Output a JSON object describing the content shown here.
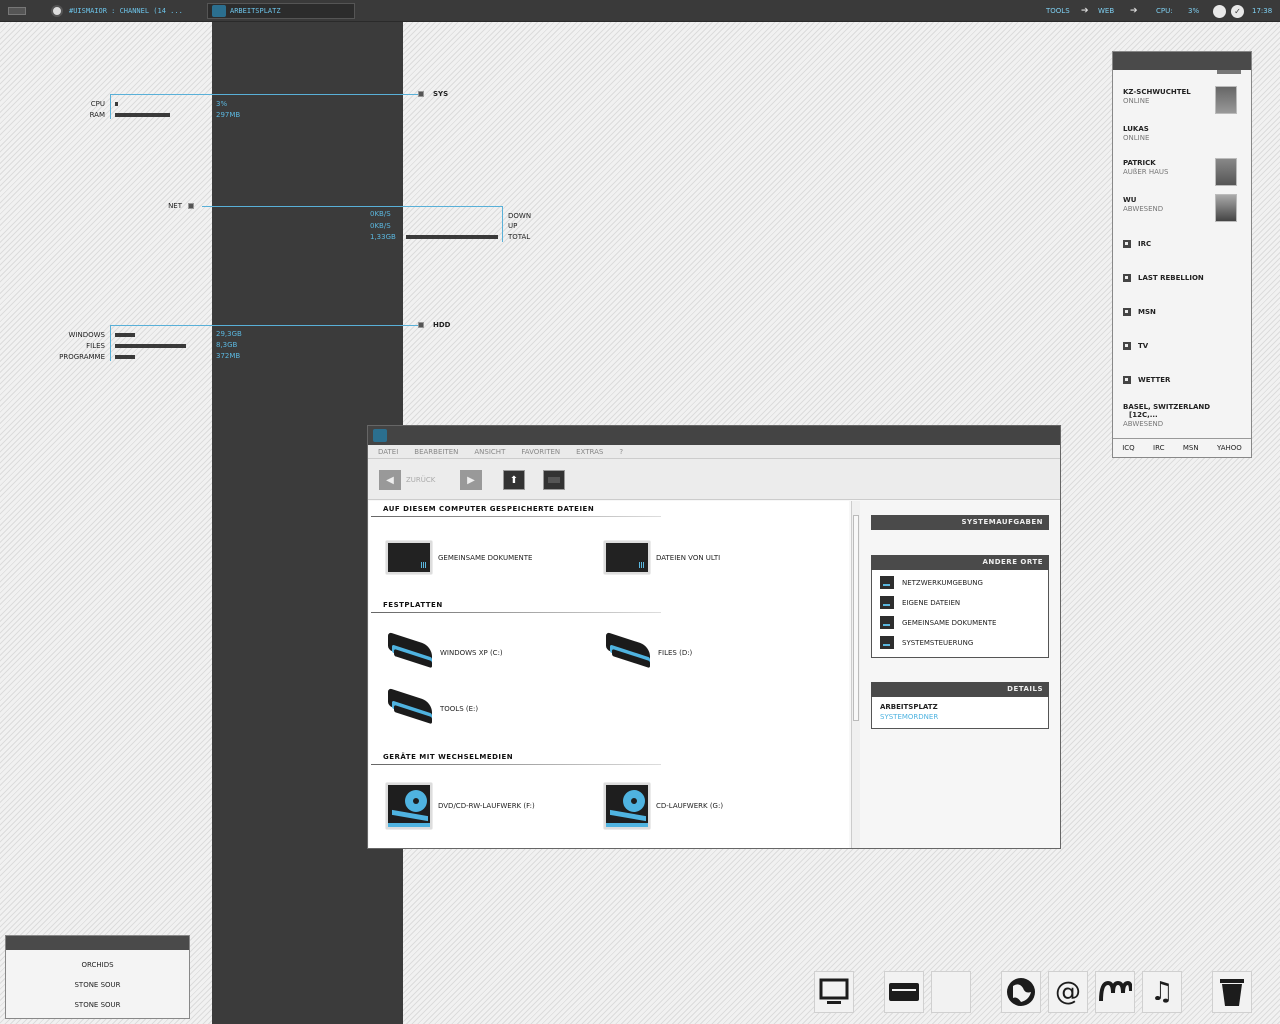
{
  "taskbar": {
    "task1": "#UISMAIOR : CHANNEL (14 ...",
    "task2": "ARBEITSPLATZ",
    "tools": "TOOLS",
    "web": "WEB",
    "cpu_label": "CPU:",
    "cpu_value": "3%",
    "time": "17:38"
  },
  "monitor": {
    "sys_title": "SYS",
    "cpu_label": "CPU",
    "cpu_value": "3%",
    "ram_label": "RAM",
    "ram_value": "297MB",
    "net_title": "NET",
    "down_value": "0KB/S",
    "up_value": "0KB/S",
    "total_value": "1,33GB",
    "down_label": "DOWN",
    "up_label": "UP",
    "total_label": "TOTAL",
    "hdd_title": "HDD",
    "drives": [
      {
        "label": "WINDOWS",
        "value": "29,3GB"
      },
      {
        "label": "FILES",
        "value": "8,3GB"
      },
      {
        "label": "PROGRAMME",
        "value": "372MB"
      }
    ]
  },
  "buddies": [
    {
      "name": "KZ-SCHWUCHTEL",
      "status": "ONLINE"
    },
    {
      "name": "LUKAS",
      "status": "ONLINE"
    },
    {
      "name": "PATRICK",
      "status": "AUßER HAUS"
    },
    {
      "name": "WU",
      "status": "ABWESEND"
    }
  ],
  "buddy_groups": [
    "IRC",
    "LAST REBELLION",
    "MSN",
    "TV",
    "WETTER"
  ],
  "weather": {
    "location": "BASEL, SWITZERLAND",
    "temp": "[12C,...",
    "status": "ABWESEND"
  },
  "buddy_tabs": [
    "ICQ",
    "IRC",
    "MSN",
    "YAHOO"
  ],
  "music": [
    "ORCHIDS",
    "STONE SOUR",
    "STONE SOUR"
  ],
  "explorer": {
    "menu": [
      "DATEI",
      "BEARBEITEN",
      "ANSICHT",
      "FAVORITEN",
      "EXTRAS",
      "?"
    ],
    "back_label": "ZURÜCK",
    "section1": "AUF DIESEM COMPUTER GESPEICHERTE DATEIEN",
    "folders": [
      "GEMEINSAME DOKUMENTE",
      "DATEIEN VON ULTI"
    ],
    "section2": "FESTPLATTEN",
    "drives": [
      "WINDOWS XP (C:)",
      "FILES (D:)",
      "TOOLS (E:)"
    ],
    "section3": "GERÄTE MIT WECHSELMEDIEN",
    "removable": [
      "DVD/CD-RW-LAUFWERK (F:)",
      "CD-LAUFWERK (G:)"
    ],
    "tasks_title": "SYSTEMAUFGABEN",
    "places_title": "ANDERE ORTE",
    "places": [
      "NETZWERKUMGEBUNG",
      "EIGENE DATEIEN",
      "GEMEINSAME DOKUMENTE",
      "SYSTEMSTEUERUNG"
    ],
    "details_title": "DETAILS",
    "details_name": "ARBEITSPLATZ",
    "details_type": "SYSTEMORDNER"
  },
  "colors": {
    "accent": "#4fb3e0",
    "dark": "#3b3b3b"
  },
  "dock_icons": [
    "monitor-icon",
    "drive-icon",
    "blank-icon",
    "globe-icon",
    "at-icon",
    "messenger-icon",
    "music-note-icon",
    "trash-icon"
  ]
}
